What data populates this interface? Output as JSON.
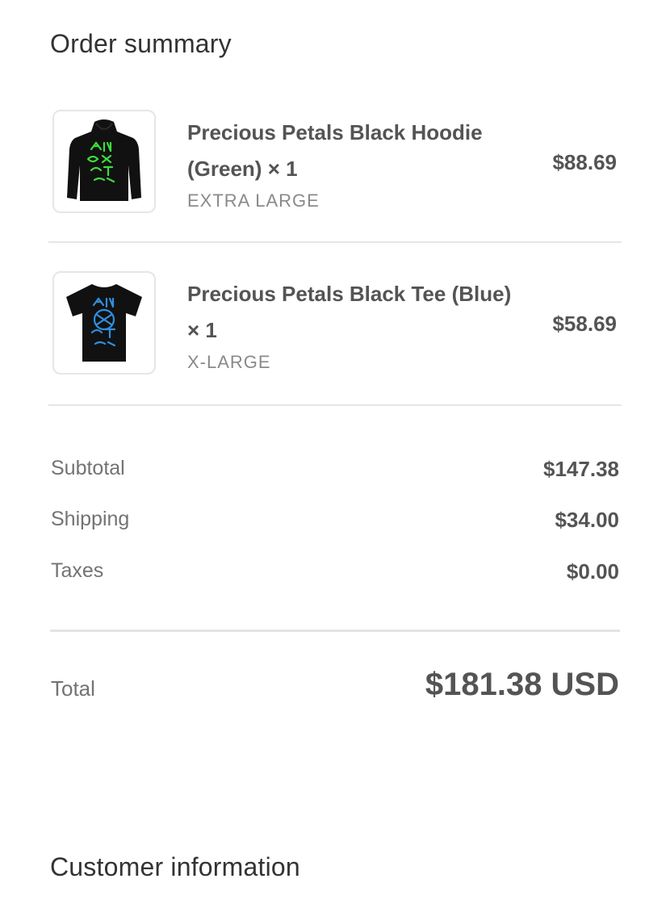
{
  "order_summary": {
    "title": "Order summary",
    "items": [
      {
        "name": "Precious Petals Black Hoodie (Green)",
        "quantity": "× 1",
        "variant": "EXTRA LARGE",
        "price": "$88.69",
        "thumbnail_icon": "hoodie-icon",
        "graphic_color": "#3ddc3d"
      },
      {
        "name": "Precious Petals Black Tee (Blue)",
        "quantity": "× 1",
        "variant": "X-LARGE",
        "price": "$58.69",
        "thumbnail_icon": "tshirt-icon",
        "graphic_color": "#2f8fe0"
      }
    ],
    "subtotal": {
      "label": "Subtotal",
      "value": "$147.38"
    },
    "shipping": {
      "label": "Shipping",
      "value": "$34.00"
    },
    "taxes": {
      "label": "Taxes",
      "value": "$0.00"
    },
    "total": {
      "label": "Total",
      "value": "$181.38 USD"
    }
  },
  "customer_information": {
    "title": "Customer information"
  },
  "colors": {
    "text_primary": "#545454",
    "text_muted": "#737373",
    "border": "#e6e6e6"
  }
}
